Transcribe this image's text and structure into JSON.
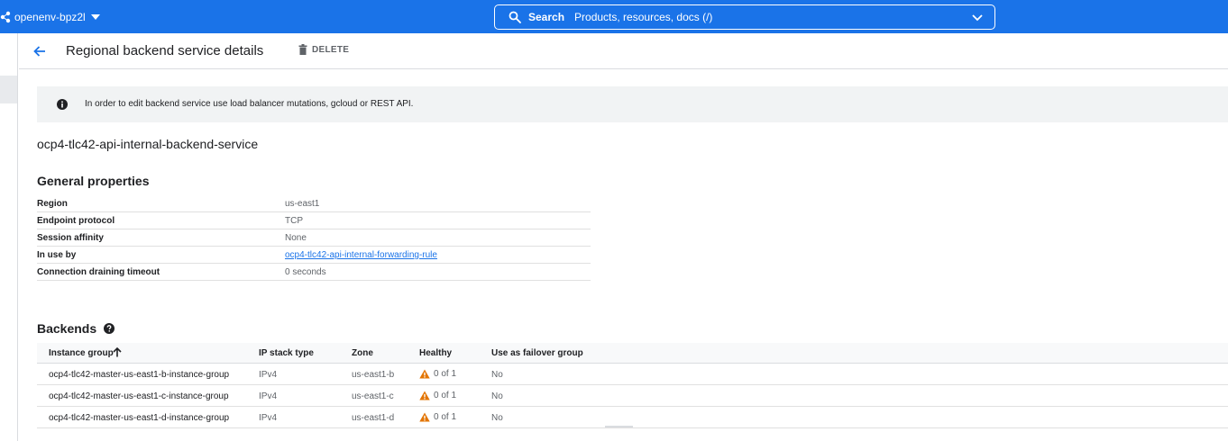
{
  "topbar": {
    "project_name": "openenv-bpz2l",
    "search_label": "Search",
    "search_placeholder": "Products, resources, docs (/)",
    "bar_color": "#1a73e8"
  },
  "header": {
    "title": "Regional backend service details",
    "delete_label": "DELETE"
  },
  "banner": {
    "message": "In order to edit backend service use load balancer mutations, gcloud or REST API."
  },
  "service_name": "ocp4-tlc42-api-internal-backend-service",
  "general": {
    "heading": "General properties",
    "rows": [
      {
        "key": "Region",
        "value": "us-east1"
      },
      {
        "key": "Endpoint protocol",
        "value": "TCP"
      },
      {
        "key": "Session affinity",
        "value": "None"
      },
      {
        "key": "In use by",
        "value": "ocp4-tlc42-api-internal-forwarding-rule"
      },
      {
        "key": "Connection draining timeout",
        "value": "0 seconds"
      }
    ]
  },
  "backends": {
    "heading": "Backends",
    "columns": [
      "Instance group",
      "IP stack type",
      "Zone",
      "Healthy",
      "Use as failover group"
    ],
    "rows": [
      {
        "group": "ocp4-tlc42-master-us-east1-b-instance-group",
        "ip": "IPv4",
        "zone": "us-east1-b",
        "healthy": "0 of 1",
        "failover": "No"
      },
      {
        "group": "ocp4-tlc42-master-us-east1-c-instance-group",
        "ip": "IPv4",
        "zone": "us-east1-c",
        "healthy": "0 of 1",
        "failover": "No"
      },
      {
        "group": "ocp4-tlc42-master-us-east1-d-instance-group",
        "ip": "IPv4",
        "zone": "us-east1-d",
        "healthy": "0 of 1",
        "failover": "No"
      }
    ]
  },
  "colors": {
    "accent": "#1a73e8",
    "warning": "#e37400"
  }
}
